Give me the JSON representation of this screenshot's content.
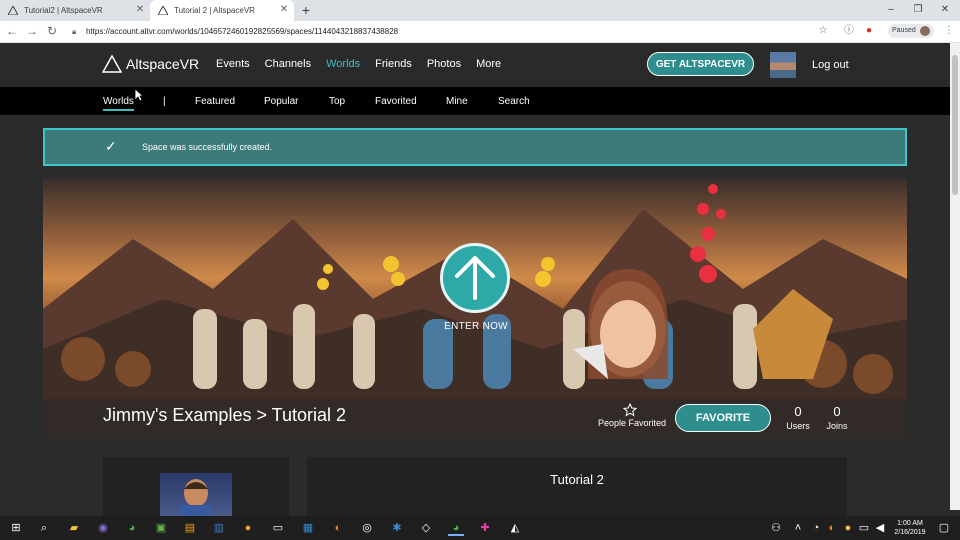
{
  "browser": {
    "tabs": [
      {
        "title": "Tutorial2 | AltspaceVR",
        "active": false
      },
      {
        "title": "Tutorial 2 | AltspaceVR",
        "active": true
      }
    ],
    "url": "https://account.altvr.com/worlds/1046572460192825569/spaces/1144043218837438828",
    "profile_status": "Paused",
    "icons": {
      "back": "arrow-left",
      "forward": "arrow-right",
      "reload": "reload",
      "lock": "lock",
      "bookmark": "star",
      "menu": "kebab"
    }
  },
  "site": {
    "logo_text": "AltspaceVR",
    "nav": [
      "Events",
      "Channels",
      "Worlds",
      "Friends",
      "Photos",
      "More"
    ],
    "nav_selected": "Worlds",
    "cta": "GET ALTSPACEVR",
    "logout": "Log out",
    "accent_color": "#3fbfbf"
  },
  "subnav": {
    "items": [
      "Worlds",
      "|",
      "Featured",
      "Popular",
      "Top",
      "Favorited",
      "Mine",
      "Search"
    ],
    "selected": "Worlds"
  },
  "alert": {
    "message": "Space was successfully created."
  },
  "hero": {
    "enter_label": "ENTER NOW",
    "title": "Jimmy's Examples > Tutorial 2",
    "favorited_label": "People Favorited",
    "favorite_button": "FAVORITE",
    "users_count": "0",
    "users_label": "Users",
    "joins_count": "0",
    "joins_label": "Joins"
  },
  "details": {
    "title": "Tutorial 2"
  },
  "taskbar": {
    "time": "1:00 AM",
    "date": "2/16/2019"
  }
}
